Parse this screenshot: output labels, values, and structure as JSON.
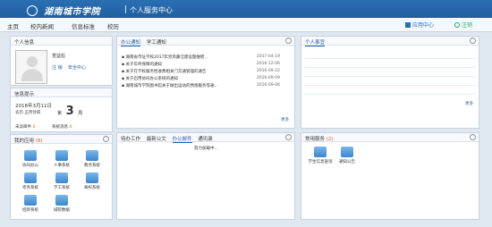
{
  "header": {
    "logo_text": "湖南城市学院",
    "site_title": "个人服务中心"
  },
  "nav": {
    "items": [
      "主页",
      "校内新闻",
      "信息标准",
      "校历"
    ],
    "app_center": "应用中心",
    "logout": "注销"
  },
  "profile": {
    "title": "个人信息",
    "name": "党益彪",
    "logout": "注 销",
    "security": "安全中心"
  },
  "notice": {
    "title": "信息提示",
    "date": "2018年3月11日",
    "weekday_label": "农历",
    "lunar": "正月廿四",
    "week_prefix": "第",
    "week_number": "3",
    "week_suffix": "周",
    "mail_label": "未读邮件",
    "mail_count": "0",
    "system_label": "系统消息",
    "system_count": "0"
  },
  "my_apps": {
    "title": "我的应用",
    "count": "(8)",
    "items": [
      "协同办公",
      "人事系统",
      "教务系统",
      "考务系统",
      "学工系统",
      "离校系统",
      "招新系统",
      "城院数据"
    ]
  },
  "office": {
    "tabs": [
      "办公通知",
      "学工通知"
    ],
    "items": [
      {
        "title": "湖南省市址学校2017年党风廉洁建设暨维稳...",
        "date": "2017-04-19"
      },
      {
        "title": "关于年终保障的通知",
        "date": "2016-12-06"
      },
      {
        "title": "关于在学校服务性收费相关门交通管理的通告",
        "date": "2016-09-22"
      },
      {
        "title": "关于启用协同办公系统的通知",
        "date": "2016-09-09"
      },
      {
        "title": "湖南城市学院图书馆关于做出运动的预感服务等通...",
        "date": "2016-09-06"
      }
    ],
    "more": "更多"
  },
  "personal": {
    "title": "个人事宜",
    "more": "更多"
  },
  "todo": {
    "tabs": [
      "待办工作",
      "最新公文",
      "办公邮件",
      "通讯录"
    ],
    "loading": "努力加载中..."
  },
  "services": {
    "title": "常用服务",
    "count": "(2)",
    "items": [
      "学生信息查询",
      "通知公告"
    ]
  },
  "colors": {
    "header": "#1f5f9e",
    "accent": "#3b86cf",
    "alert": "#e85a2b"
  }
}
